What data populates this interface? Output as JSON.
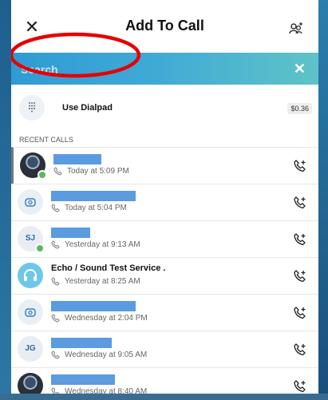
{
  "header": {
    "title": "Add To Call"
  },
  "search": {
    "placeholder": "Search"
  },
  "dialpad": {
    "label": "Use Dialpad",
    "price": "$0.36"
  },
  "recent": {
    "heading": "RECENT CALLS",
    "items": [
      {
        "name": "",
        "time": "Today at 5:09 PM"
      },
      {
        "name": "",
        "time": "Today at 5:04 PM"
      },
      {
        "initials": "SJ",
        "name": "",
        "time": "Yesterday at 9:13 AM"
      },
      {
        "name": "Echo / Sound Test Service .",
        "time": "Yesterday at 8:25 AM"
      },
      {
        "name": "",
        "time": "Wednesday at 2:04 PM"
      },
      {
        "initials": "JG",
        "name": "",
        "time": "Wednesday at 9:05 AM"
      },
      {
        "name": "",
        "time": "Wednesday at 8:40 AM"
      }
    ]
  },
  "colors": {
    "accent": "#3fa9d6",
    "redaction": "#5b9be0",
    "presence": "#5cb85c",
    "annotation": "#e60000"
  },
  "icons": {
    "close": "close-icon",
    "add_person": "add-person-icon",
    "dialpad": "dialpad-icon",
    "add_call": "add-to-call-icon",
    "call_history": "call-history-icon"
  }
}
